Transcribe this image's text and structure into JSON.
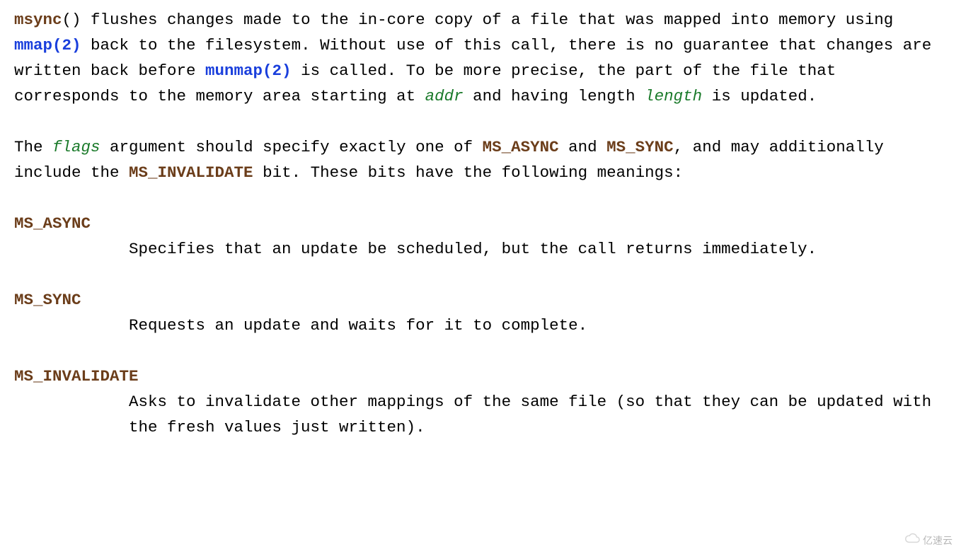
{
  "p1": {
    "func": "msync",
    "t1": "() flushes changes made to the in-core copy of a file that was mapped into memory using ",
    "link1": "mmap(2)",
    "t2": " back to the filesystem.  Without use of this call, there is no guarantee that changes are written back before ",
    "link2": "munmap(2)",
    "t3": " is called.  To be more precise, the part of the file that corresponds to the memory area starting at ",
    "param1": "addr",
    "t4": " and having length ",
    "param2": "length",
    "t5": " is updated."
  },
  "p2": {
    "t1": "The ",
    "param1": "flags",
    "t2": " argument should specify exactly one of ",
    "c1": "MS_ASYNC",
    "t3": " and ",
    "c2": "MS_SYNC",
    "t4": ", and may additionally include the ",
    "c3": "MS_INVALIDATE",
    "t5": " bit.  These bits have the following meanings:"
  },
  "flags": {
    "f1": {
      "name": "MS_ASYNC",
      "desc": "Specifies that an update be scheduled, but the call returns immediately."
    },
    "f2": {
      "name": "MS_SYNC",
      "desc": "Requests an update and waits for it to complete."
    },
    "f3": {
      "name": "MS_INVALIDATE",
      "desc": "Asks to invalidate other mappings of the same file (so that they can be updated with the fresh values just written)."
    }
  },
  "watermark": "亿速云"
}
